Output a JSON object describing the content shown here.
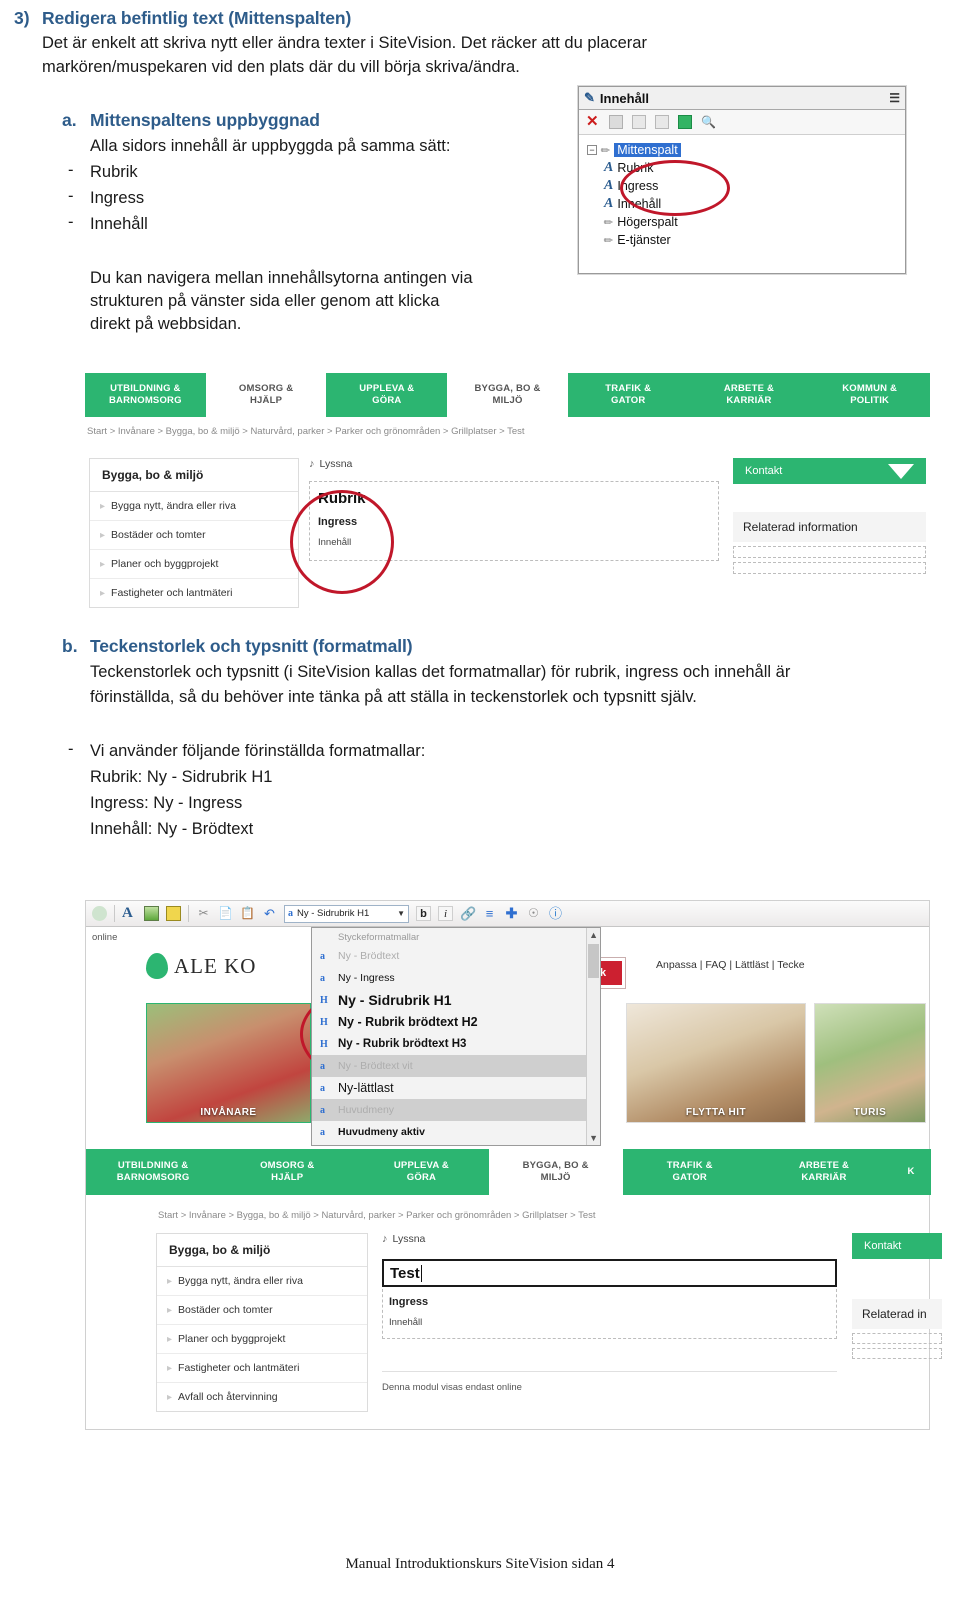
{
  "document": {
    "section": {
      "number": "3)",
      "heading": "Redigera befintlig text (Mittenspalten)",
      "paragraph_line1": "Det är enkelt att skriva nytt eller ändra texter i SiteVision. Det räcker att du placerar",
      "paragraph_line2": "markören/muspekaren vid den plats där du vill börja skriva/ändra."
    },
    "sub_a": {
      "marker": "a.",
      "heading": "Mittenspaltens uppbyggnad",
      "intro": "Alla sidors innehåll är uppbyggda på samma sätt:",
      "bullets": [
        {
          "dash": "-",
          "label": "Rubrik"
        },
        {
          "dash": "-",
          "label": "Ingress"
        },
        {
          "dash": "-",
          "label": "Innehåll"
        }
      ],
      "note_line1": "Du kan navigera mellan innehållsytorna antingen via",
      "note_line2": "strukturen på vänster sida eller genom att klicka",
      "note_line3": "direkt på webbsidan."
    },
    "sub_b": {
      "marker": "b.",
      "heading": "Teckenstorlek och typsnitt (formatmall)",
      "paragraph_line1": "Teckenstorlek och typsnitt (i SiteVision kallas det formatmallar) för rubrik, ingress och innehåll är",
      "paragraph_line2": "förinställda, så du behöver inte tänka på att ställa in teckenstorlek och typsnitt själv.",
      "list_dash": "-",
      "list_intro": "Vi använder följande förinställda formatmallar:",
      "list_items": [
        "Rubrik: Ny - Sidrubrik H1",
        "Ingress: Ny - Ingress",
        "Innehåll: Ny - Brödtext"
      ]
    },
    "page_footer": "Manual Introduktionskurs SiteVision sidan 4"
  },
  "tree_panel": {
    "title": "Innehåll",
    "title_icon": "content-icon",
    "menu_icon": "panel-menu-icon",
    "toolbar_icons": [
      "delete-icon",
      "copy-icon",
      "duplicate-icon",
      "paste-icon",
      "module-icon",
      "preview-icon"
    ],
    "nodes": [
      {
        "icon": "pen-icon",
        "label": "Mittenspalt",
        "selected": true,
        "level": 0
      },
      {
        "icon": "text-icon",
        "label": "Rubrik",
        "selected": false,
        "level": 1
      },
      {
        "icon": "text-icon",
        "label": "Ingress",
        "selected": false,
        "level": 1
      },
      {
        "icon": "text-icon",
        "label": "Innehåll",
        "selected": false,
        "level": 1
      },
      {
        "icon": "pen-icon",
        "label": "Högerspalt",
        "selected": false,
        "level": 1
      },
      {
        "icon": "pen-icon",
        "label": "E-tjänster",
        "selected": false,
        "level": 1
      }
    ]
  },
  "website_top": {
    "nav": [
      {
        "line1": "UTBILDNING &",
        "line2": "BARNOMSORG",
        "active": false
      },
      {
        "line1": "OMSORG &",
        "line2": "HJÄLP",
        "active": true
      },
      {
        "line1": "UPPLEVA &",
        "line2": "GÖRA",
        "active": false
      },
      {
        "line1": "BYGGA, BO &",
        "line2": "MILJÖ",
        "active": true
      },
      {
        "line1": "TRAFIK &",
        "line2": "GATOR",
        "active": false
      },
      {
        "line1": "ARBETE &",
        "line2": "KARRIÄR",
        "active": false
      },
      {
        "line1": "KOMMUN &",
        "line2": "POLITIK",
        "active": false
      }
    ],
    "breadcrumb": "Start > Invånare > Bygga, bo & miljö > Naturvård, parker > Parker och grönområden > Grillplatser > Test",
    "left_menu_header": "Bygga, bo & miljö",
    "left_menu_items": [
      "Bygga nytt, ändra eller riva",
      "Bostäder och tomter",
      "Planer och byggprojekt",
      "Fastigheter och lantmäteri"
    ],
    "listen_label": "Lyssna",
    "listen_icon": "speaker-icon",
    "content_rubrik": "Rubrik",
    "content_ingress": "Ingress",
    "content_innehall": "Innehåll",
    "kontakt_label": "Kontakt",
    "kontakt_caret_icon": "caret-down-icon",
    "related_label": "Relaterad information"
  },
  "editor": {
    "online_label": "online",
    "toolbar_icons": [
      "status-dot-icon",
      "font-icon",
      "image-icon",
      "module-icon",
      "cut-icon",
      "copy-icon",
      "paste-icon",
      "undo-icon"
    ],
    "toolbar_icons_right": [
      "bold-icon",
      "italic-icon",
      "link-icon",
      "list-icon",
      "add-icon",
      "anchor-icon",
      "help-icon"
    ],
    "style_combo_value": "Ny - Sidrubrik H1",
    "style_combo_icon": "paragraph-style-icon",
    "dropdown": {
      "group_label": "Styckeformatmallar",
      "items": [
        {
          "label": "Ny - Brödtext",
          "style": "normal",
          "state": "dim"
        },
        {
          "label": "Ny - Ingress",
          "style": "normal",
          "state": "normal"
        },
        {
          "label": "Ny - Sidrubrik H1",
          "style": "h1",
          "state": "normal"
        },
        {
          "label": "Ny - Rubrik brödtext H2",
          "style": "h2",
          "state": "normal"
        },
        {
          "label": "Ny - Rubrik brödtext H3",
          "style": "h3",
          "state": "normal"
        },
        {
          "label": "Ny - Brödtext vit",
          "style": "normal",
          "state": "selected"
        },
        {
          "label": "Ny-lättlast",
          "style": "lattlast",
          "state": "normal"
        },
        {
          "label": "Huvudmeny",
          "style": "normal",
          "state": "selected"
        },
        {
          "label": "Huvudmeny aktiv",
          "style": "bold",
          "state": "normal"
        }
      ],
      "scroll_up_icon": "chevron-up-icon",
      "scroll_down_icon": "chevron-down-icon"
    },
    "site_logo_text": "ALE KO",
    "site_logo_icon": "leaf-icon",
    "top_links": "Anpassa | FAQ | Lättläst | Tecke",
    "search_button": "Sök",
    "cards": [
      {
        "caption": "INVÅNARE"
      },
      {
        "caption": "FLYTTA HIT"
      },
      {
        "caption": "TURIS"
      }
    ],
    "nav": [
      {
        "line1": "UTBILDNING &",
        "line2": "BARNOMSORG",
        "active": false
      },
      {
        "line1": "OMSORG &",
        "line2": "HJÄLP",
        "active": false
      },
      {
        "line1": "UPPLEVA &",
        "line2": "GÖRA",
        "active": false
      },
      {
        "line1": "BYGGA, BO &",
        "line2": "MILJÖ",
        "active": true
      },
      {
        "line1": "TRAFIK &",
        "line2": "GATOR",
        "active": false
      },
      {
        "line1": "ARBETE &",
        "line2": "KARRIÄR",
        "active": false
      },
      {
        "line1": "K",
        "line2": "",
        "active": false
      }
    ],
    "breadcrumb": "Start > Invånare > Bygga, bo & miljö > Naturvård, parker > Parker och grönområden > Grillplatser > Test",
    "left_menu_header": "Bygga, bo & miljö",
    "left_menu_items": [
      "Bygga nytt, ändra eller riva",
      "Bostäder och tomter",
      "Planer och byggprojekt",
      "Fastigheter och lantmäteri",
      "Avfall och återvinning"
    ],
    "listen_label": "Lyssna",
    "title_field_value": "Test",
    "content_ingress": "Ingress",
    "content_innehall": "Innehåll",
    "kontakt_label": "Kontakt",
    "related_label": "Relaterad in",
    "module_note": "Denna modul visas endast online"
  },
  "colors": {
    "heading_blue": "#2E5C8A",
    "brand_green": "#2cb571",
    "annotation_red": "#c0172a",
    "search_red": "#cc2030",
    "tree_select_blue": "#2f6fd0"
  }
}
